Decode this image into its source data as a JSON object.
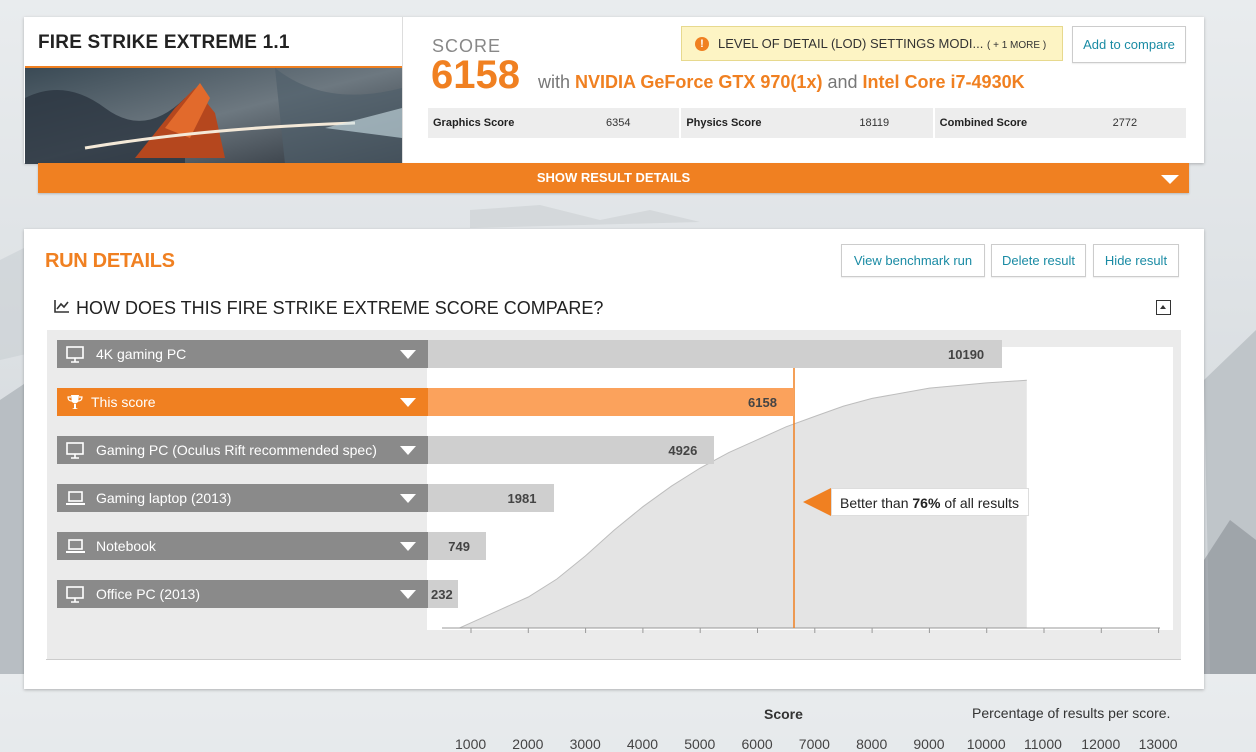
{
  "header": {
    "benchmark_title": "FIRE STRIKE EXTREME 1.1",
    "score_label": "SCORE",
    "score_value": "6158",
    "with_text": "with",
    "gpu": "NVIDIA GeForce GTX 970(1x)",
    "and_text": "and",
    "cpu": "Intel Core i7-4930K",
    "warning_text": "LEVEL OF DETAIL (LOD) SETTINGS MODI...",
    "warning_more": "( + 1 MORE )",
    "add_compare_label": "Add to compare",
    "subscores": [
      {
        "name": "Graphics Score",
        "value": "6354"
      },
      {
        "name": "Physics Score",
        "value": "18119"
      },
      {
        "name": "Combined Score",
        "value": "2772"
      }
    ],
    "show_details_label": "SHOW RESULT DETAILS"
  },
  "run_details": {
    "title": "RUN DETAILS",
    "view_run_label": "View benchmark run",
    "delete_label": "Delete result",
    "hide_label": "Hide result",
    "compare_title": "HOW DOES THIS FIRE STRIKE EXTREME SCORE COMPARE?"
  },
  "chart_data": {
    "type": "bar",
    "categories": [
      "4K gaming PC",
      "This score",
      "Gaming PC (Oculus Rift recommended spec)",
      "Gaming laptop (2013)",
      "Notebook",
      "Office PC (2013)"
    ],
    "values": [
      10190,
      6158,
      4926,
      1981,
      749,
      232
    ],
    "value_labels": [
      "10190",
      "6158",
      "4926",
      "1981",
      "749",
      "232"
    ],
    "highlight": "This score",
    "row_icons": [
      "desktop-icon",
      "trophy-icon",
      "desktop-icon",
      "laptop-icon",
      "laptop-icon",
      "desktop-icon"
    ],
    "percentile_text_before": "Better than",
    "percentile_value": "76%",
    "percentile_text_after": "of all results",
    "xlabel": "Score",
    "distribution_label": "Percentage of results per score.",
    "xticks": [
      "1000",
      "2000",
      "3000",
      "4000",
      "5000",
      "6000",
      "7000",
      "8000",
      "9000",
      "10000",
      "11000",
      "12000",
      "13000"
    ],
    "xlim": [
      600,
      13400
    ],
    "distribution_curve": {
      "x": [
        800,
        1000,
        1500,
        2000,
        2500,
        3000,
        3500,
        4000,
        4500,
        5000,
        5500,
        6000,
        6500,
        7000,
        7500,
        8000,
        9000,
        10000,
        10700
      ],
      "y": [
        0.0,
        0.02,
        0.07,
        0.12,
        0.19,
        0.28,
        0.38,
        0.47,
        0.55,
        0.62,
        0.68,
        0.73,
        0.78,
        0.82,
        0.86,
        0.89,
        0.93,
        0.95,
        0.96
      ]
    },
    "grid": false
  },
  "colors": {
    "accent": "#f08021",
    "link": "#1a8ba4",
    "bar": "#cfcfcf",
    "bar_active": "#fba25c",
    "label_bg": "#8a8a8a"
  }
}
